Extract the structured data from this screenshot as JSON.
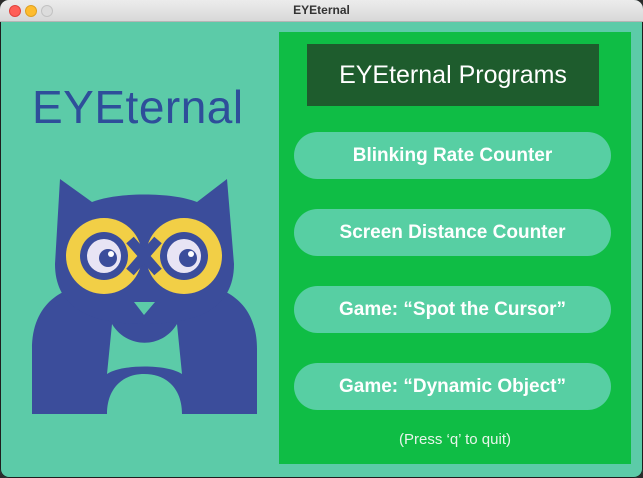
{
  "window": {
    "title": "EYEternal"
  },
  "brand": {
    "name": "EYEternal",
    "color": "#2e4e9a"
  },
  "panel": {
    "header": "EYEternal Programs",
    "programs": [
      {
        "label": "Blinking Rate Counter"
      },
      {
        "label": "Screen Distance Counter"
      },
      {
        "label": "Game: “Spot the Cursor”"
      },
      {
        "label": "Game: “Dynamic Object”"
      }
    ],
    "quit_hint": "(Press ‘q’ to quit)"
  },
  "colors": {
    "background": "#5ccba8",
    "panel": "#0fbd45",
    "header": "#1e5c2d",
    "button": "#57cfa3",
    "owl_body": "#3b4d9b",
    "owl_goggles": "#f2cf46"
  }
}
